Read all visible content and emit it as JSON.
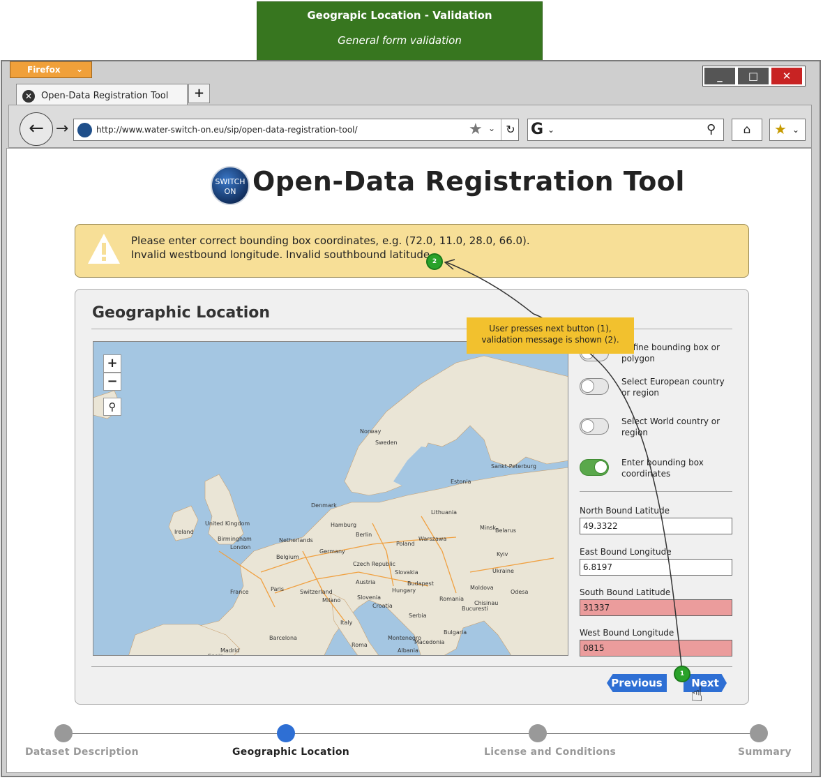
{
  "banner": {
    "title": "Geograpic Location - Validation",
    "subtitle": "General form validation"
  },
  "browser": {
    "menu_label": "Firefox",
    "tab_label": "Open-Data Registration Tool",
    "new_tab_label": "+",
    "url": "http://www.water-switch-on.eu/sip/open-data-registration-tool/",
    "search_value": "",
    "window_controls": {
      "minimize": "_",
      "maximize": "□",
      "close": "✕"
    }
  },
  "page": {
    "title": "Open-Data Registration Tool",
    "logo_text": "SWITCH ON"
  },
  "alert": {
    "line1": "Please enter correct bounding box coordinates, e.g. (72.0, 11.0, 28.0, 66.0).",
    "line2": "Invalid westbound longitude. Invalid southbound latitude."
  },
  "section": {
    "title": "Geographic Location"
  },
  "map": {
    "zoom_in": "+",
    "zoom_out": "−",
    "labels": [
      "Norway",
      "Sweden",
      "Estonia",
      "Lithuania",
      "Denmark",
      "United Kingdom",
      "Ireland",
      "London",
      "Netherlands",
      "Belgium",
      "Germany",
      "Poland",
      "Warszawa",
      "Berlin",
      "Czech Republic",
      "Slovakia",
      "Austria",
      "Hungary",
      "Ukraine",
      "Kyiv",
      "Moldova",
      "Romania",
      "France",
      "Paris",
      "Switzerland",
      "Milano",
      "Slovenia",
      "Croatia",
      "Serbia",
      "Bucuresti",
      "Bulgaria",
      "Italy",
      "Roma",
      "Montenegro",
      "Macedonia",
      "Albania",
      "Barcelona",
      "Madrid",
      "Spain",
      "Minsk",
      "Belarus",
      "Budapest",
      "Hamburg",
      "Birmingham",
      "Odesa",
      "Chisinau",
      "Sankt-Peterburg"
    ]
  },
  "options": [
    {
      "label": "Define bounding box or polygon",
      "on": false
    },
    {
      "label": "Select European country or region",
      "on": false
    },
    {
      "label": "Select World country or region",
      "on": false
    },
    {
      "label": "Enter bounding box coordinates",
      "on": true
    }
  ],
  "fields": {
    "north": {
      "label": "North Bound Latitude",
      "value": "49.3322"
    },
    "east": {
      "label": "East Bound Longitude",
      "value": "6.8197"
    },
    "south": {
      "label": "South Bound Latitude",
      "value": "31337"
    },
    "west": {
      "label": "West Bound Longitude",
      "value": "0815"
    }
  },
  "buttons": {
    "previous": "Previous",
    "next": "Next"
  },
  "steps": [
    {
      "label": "Dataset Description",
      "active": false
    },
    {
      "label": "Geographic Location",
      "active": true
    },
    {
      "label": "License and Conditions",
      "active": false
    },
    {
      "label": "Summary",
      "active": false
    }
  ],
  "annotation": {
    "note_line1": "User presses next button (1),",
    "note_line2": "validation message is shown (2).",
    "badge1": "1",
    "badge2": "2"
  },
  "colors": {
    "error": "#eb9c9c",
    "accent": "#2e6fd4",
    "alert_bg": "#f7df97",
    "banner_bg": "#37761f",
    "toggle_on": "#5aa84b"
  }
}
